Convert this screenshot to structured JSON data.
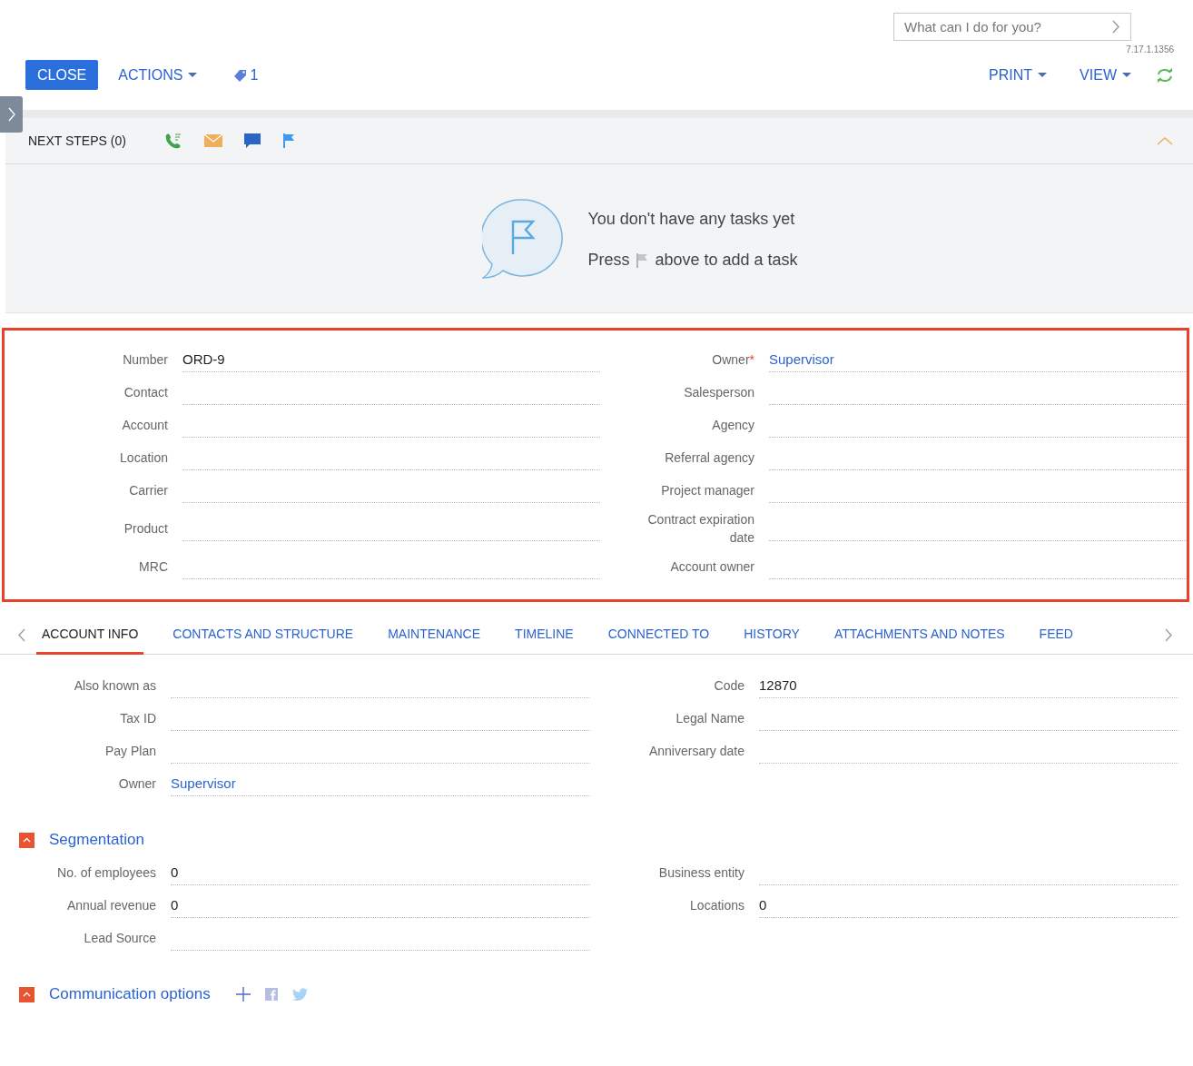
{
  "search": {
    "placeholder": "What can I do for you?"
  },
  "version": "7.17.1.1356",
  "toolbar": {
    "close": "CLOSE",
    "actions": "ACTIONS",
    "tag_count": "1",
    "print": "PRINT",
    "view": "VIEW"
  },
  "next_steps": {
    "title": "NEXT STEPS (0)",
    "expanded": true,
    "empty_title": "You don't have any tasks yet",
    "empty_hint_before": "Press",
    "empty_hint_after": "above to add a task"
  },
  "header_form": {
    "left": [
      {
        "label": "Number",
        "value": "ORD-9",
        "kind": "text"
      },
      {
        "label": "Contact",
        "kind": "text"
      },
      {
        "label": "Account",
        "kind": "text"
      },
      {
        "label": "Location",
        "kind": "text"
      },
      {
        "label": "Carrier",
        "kind": "text"
      },
      {
        "label": "Product",
        "kind": "text"
      },
      {
        "label": "MRC",
        "kind": "text"
      }
    ],
    "right": [
      {
        "label": "Owner",
        "required_mark": "*",
        "value": "Supervisor",
        "kind": "link"
      },
      {
        "label": "Salesperson",
        "kind": "text"
      },
      {
        "label": "Agency",
        "kind": "text"
      },
      {
        "label": "Referral agency",
        "kind": "text"
      },
      {
        "label": "Project manager",
        "kind": "text"
      },
      {
        "label": "Contract expiration date",
        "kind": "text"
      },
      {
        "label": "Account owner",
        "kind": "text"
      }
    ]
  },
  "tabs": [
    {
      "label": "ACCOUNT INFO",
      "selected": true
    },
    {
      "label": "CONTACTS AND STRUCTURE",
      "selected": false
    },
    {
      "label": "MAINTENANCE",
      "selected": false
    },
    {
      "label": "TIMELINE",
      "selected": false
    },
    {
      "label": "CONNECTED TO",
      "selected": false
    },
    {
      "label": "HISTORY",
      "selected": false
    },
    {
      "label": "ATTACHMENTS AND NOTES",
      "selected": false
    },
    {
      "label": "FEED",
      "selected": false
    }
  ],
  "account_info": {
    "left": [
      {
        "label": "Also known as",
        "kind": "text"
      },
      {
        "label": "Tax ID",
        "kind": "text"
      },
      {
        "label": "Pay Plan",
        "kind": "text"
      },
      {
        "label": "Owner",
        "value": "Supervisor",
        "kind": "link"
      }
    ],
    "right": [
      {
        "label": "Code",
        "value": "12870",
        "kind": "text"
      },
      {
        "label": "Legal Name",
        "kind": "text"
      },
      {
        "label": "Anniversary date",
        "kind": "text"
      }
    ]
  },
  "segmentation": {
    "title": "Segmentation",
    "expanded": true,
    "left": [
      {
        "label": "No. of employees",
        "value": "0",
        "kind": "text"
      },
      {
        "label": "Annual revenue",
        "value": "0",
        "kind": "text"
      },
      {
        "label": "Lead Source",
        "kind": "text"
      }
    ],
    "right": [
      {
        "label": "Business entity",
        "kind": "text"
      },
      {
        "label": "Locations",
        "value": "0",
        "kind": "text"
      }
    ]
  },
  "communication_options": {
    "title": "Communication options",
    "expanded": true
  }
}
